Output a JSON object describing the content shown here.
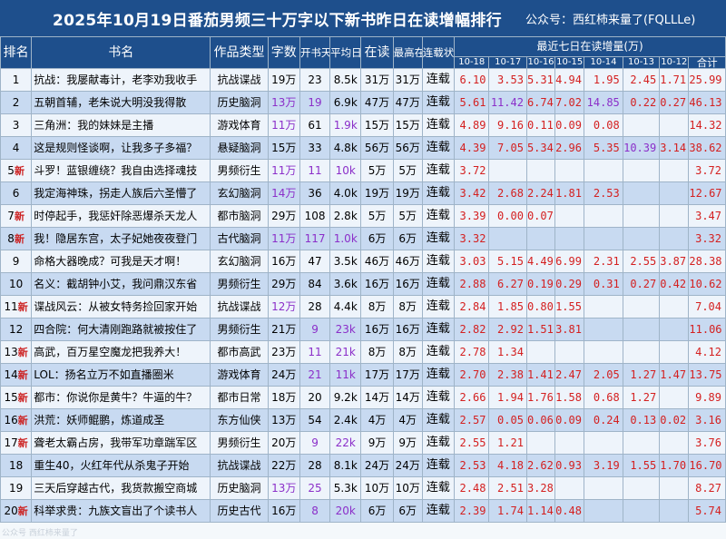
{
  "title": {
    "main": "2025年10月19日番茄男频三十万字以下新书昨日在读增幅排行",
    "sub": "公众号：西红柿来量了(FQLLLe)"
  },
  "headers": {
    "rank": "排名",
    "name": "书名",
    "type": "作品类型",
    "words": "字数",
    "days": "开书天数",
    "avg": "平均日更",
    "reading": "在读",
    "max": "最高在读",
    "status": "连载状态",
    "recent": "最近七日在读增量(万)",
    "day_labels": [
      "10-18",
      "10-17",
      "10-16",
      "10-15",
      "10-14",
      "10-13",
      "10-12"
    ],
    "total": "合计"
  },
  "new_badge": "新",
  "rows": [
    {
      "rank": "1",
      "is_new": false,
      "name": "抗战：我屡献毒计，老李劝我收手",
      "type": "抗战谍战",
      "words": "19万",
      "days": "23",
      "avg": "8.5k",
      "reading": "31万",
      "max": "31万",
      "status": "连载",
      "d": [
        "6.10",
        "3.53",
        "5.31",
        "4.94",
        "1.95",
        "2.45",
        "1.71"
      ],
      "total": "25.99"
    },
    {
      "rank": "2",
      "is_new": false,
      "name": "五朝首辅，老朱说大明没我得散",
      "type": "历史脑洞",
      "words": "13万",
      "days": "19",
      "avg": "6.9k",
      "reading": "47万",
      "max": "47万",
      "status": "连载",
      "d": [
        "5.61",
        "11.42",
        "6.74",
        "7.02",
        "14.85",
        "0.22",
        "0.27"
      ],
      "total": "46.13"
    },
    {
      "rank": "3",
      "is_new": false,
      "name": "三角洲：我的妹妹是主播",
      "type": "游戏体育",
      "words": "11万",
      "days": "61",
      "avg": "1.9k",
      "reading": "15万",
      "max": "15万",
      "status": "连载",
      "d": [
        "4.89",
        "9.16",
        "0.11",
        "0.09",
        "0.08",
        "",
        ""
      ],
      "total": "14.32"
    },
    {
      "rank": "4",
      "is_new": false,
      "name": "这是规则怪谈啊，让我多子多福？",
      "type": "悬疑脑洞",
      "words": "15万",
      "days": "33",
      "avg": "4.8k",
      "reading": "56万",
      "max": "56万",
      "status": "连载",
      "d": [
        "4.39",
        "7.05",
        "5.34",
        "2.96",
        "5.35",
        "10.39",
        "3.14"
      ],
      "total": "38.62"
    },
    {
      "rank": "5",
      "is_new": true,
      "name": "斗罗！蓝银缠绕？我自由选择魂技",
      "type": "男频衍生",
      "words": "11万",
      "days": "11",
      "avg": "10k",
      "reading": "5万",
      "max": "5万",
      "status": "连载",
      "d": [
        "3.72",
        "",
        "",
        "",
        "",
        "",
        ""
      ],
      "total": "3.72"
    },
    {
      "rank": "6",
      "is_new": false,
      "name": "我定海神珠，拐走人族后六圣懵了",
      "type": "玄幻脑洞",
      "words": "14万",
      "days": "36",
      "avg": "4.0k",
      "reading": "19万",
      "max": "19万",
      "status": "连载",
      "d": [
        "3.42",
        "2.68",
        "2.24",
        "1.81",
        "2.53",
        "",
        ""
      ],
      "total": "12.67"
    },
    {
      "rank": "7",
      "is_new": true,
      "name": "时停起手，我惩奸除恶爆杀天龙人",
      "type": "都市脑洞",
      "words": "29万",
      "days": "108",
      "avg": "2.8k",
      "reading": "5万",
      "max": "5万",
      "status": "连载",
      "d": [
        "3.39",
        "0.00",
        "0.07",
        "",
        "",
        "",
        ""
      ],
      "total": "3.47"
    },
    {
      "rank": "8",
      "is_new": true,
      "name": "我！隐居东宫，太子妃她夜夜登门",
      "type": "古代脑洞",
      "words": "11万",
      "days": "117",
      "avg": "1.0k",
      "reading": "6万",
      "max": "6万",
      "status": "连载",
      "d": [
        "3.32",
        "",
        "",
        "",
        "",
        "",
        ""
      ],
      "total": "3.32"
    },
    {
      "rank": "9",
      "is_new": false,
      "name": "命格大器晚成？可我是天才啊！",
      "type": "玄幻脑洞",
      "words": "16万",
      "days": "47",
      "avg": "3.5k",
      "reading": "46万",
      "max": "46万",
      "status": "连载",
      "d": [
        "3.03",
        "5.15",
        "4.49",
        "6.99",
        "2.31",
        "2.55",
        "3.87"
      ],
      "total": "28.38"
    },
    {
      "rank": "10",
      "is_new": false,
      "name": "名义：截胡钟小艾，我问鼎汉东省",
      "type": "男频衍生",
      "words": "29万",
      "days": "84",
      "avg": "3.6k",
      "reading": "16万",
      "max": "16万",
      "status": "连载",
      "d": [
        "2.88",
        "6.27",
        "0.19",
        "0.29",
        "0.31",
        "0.27",
        "0.42"
      ],
      "total": "10.62"
    },
    {
      "rank": "11",
      "is_new": true,
      "name": "谍战风云：从被女特务捡回家开始",
      "type": "抗战谍战",
      "words": "12万",
      "days": "28",
      "avg": "4.4k",
      "reading": "8万",
      "max": "8万",
      "status": "连载",
      "d": [
        "2.84",
        "1.85",
        "0.80",
        "1.55",
        "",
        "",
        ""
      ],
      "total": "7.04"
    },
    {
      "rank": "12",
      "is_new": false,
      "name": "四合院：何大清刚跑路就被按住了",
      "type": "男频衍生",
      "words": "21万",
      "days": "9",
      "avg": "23k",
      "reading": "16万",
      "max": "16万",
      "status": "连载",
      "d": [
        "2.82",
        "2.92",
        "1.51",
        "3.81",
        "",
        "",
        ""
      ],
      "total": "11.06"
    },
    {
      "rank": "13",
      "is_new": true,
      "name": "高武，百万星空魔龙把我养大！",
      "type": "都市高武",
      "words": "23万",
      "days": "11",
      "avg": "21k",
      "reading": "8万",
      "max": "8万",
      "status": "连载",
      "d": [
        "2.78",
        "1.34",
        "",
        "",
        "",
        "",
        ""
      ],
      "total": "4.12"
    },
    {
      "rank": "14",
      "is_new": true,
      "name": "LOL：扬名立万不如直播圈米",
      "type": "游戏体育",
      "words": "24万",
      "days": "21",
      "avg": "11k",
      "reading": "17万",
      "max": "17万",
      "status": "连载",
      "d": [
        "2.70",
        "2.38",
        "1.41",
        "2.47",
        "2.05",
        "1.27",
        "1.47"
      ],
      "total": "13.75"
    },
    {
      "rank": "15",
      "is_new": true,
      "name": "都市：你说你是黄牛？牛逼的牛？",
      "type": "都市日常",
      "words": "18万",
      "days": "20",
      "avg": "9.2k",
      "reading": "14万",
      "max": "14万",
      "status": "连载",
      "d": [
        "2.66",
        "1.94",
        "1.76",
        "1.58",
        "0.68",
        "1.27",
        ""
      ],
      "total": "9.89"
    },
    {
      "rank": "16",
      "is_new": true,
      "name": "洪荒：妖师鲲鹏，炼道成圣",
      "type": "东方仙侠",
      "words": "13万",
      "days": "54",
      "avg": "2.4k",
      "reading": "4万",
      "max": "4万",
      "status": "连载",
      "d": [
        "2.57",
        "0.05",
        "0.06",
        "0.09",
        "0.24",
        "0.13",
        "0.02"
      ],
      "total": "3.16"
    },
    {
      "rank": "17",
      "is_new": true,
      "name": "聋老太霸占房，我带军功章踹军区",
      "type": "男频衍生",
      "words": "20万",
      "days": "9",
      "avg": "22k",
      "reading": "9万",
      "max": "9万",
      "status": "连载",
      "d": [
        "2.55",
        "1.21",
        "",
        "",
        "",
        "",
        ""
      ],
      "total": "3.76"
    },
    {
      "rank": "18",
      "is_new": false,
      "name": "重生40，火红年代从杀鬼子开始",
      "type": "抗战谍战",
      "words": "22万",
      "days": "28",
      "avg": "8.1k",
      "reading": "24万",
      "max": "24万",
      "status": "连载",
      "d": [
        "2.53",
        "4.18",
        "2.62",
        "0.93",
        "3.19",
        "1.55",
        "1.70"
      ],
      "total": "16.70"
    },
    {
      "rank": "19",
      "is_new": false,
      "name": "三天后穿越古代，我货款搬空商城",
      "type": "历史脑洞",
      "words": "13万",
      "days": "25",
      "avg": "5.3k",
      "reading": "10万",
      "max": "10万",
      "status": "连载",
      "d": [
        "2.48",
        "2.51",
        "3.28",
        "",
        "",
        "",
        ""
      ],
      "total": "8.27"
    },
    {
      "rank": "20",
      "is_new": true,
      "name": "科举求贵：九族文盲出了个读书人",
      "type": "历史古代",
      "words": "16万",
      "days": "8",
      "avg": "20k",
      "reading": "6万",
      "max": "6万",
      "status": "连载",
      "d": [
        "2.39",
        "1.74",
        "1.14",
        "0.48",
        "",
        "",
        ""
      ],
      "total": "5.74"
    }
  ],
  "highlight": {
    "color": "#8b2fc9",
    "words_rows": [
      2,
      3,
      5,
      6,
      8,
      11,
      19
    ],
    "days_rows": [
      2,
      5,
      8,
      12,
      13,
      14,
      17,
      19,
      20
    ],
    "avg_rows": [
      3,
      5,
      8,
      12,
      13,
      14,
      17,
      20
    ],
    "day_cells": [
      [
        2,
        1
      ],
      [
        2,
        4
      ],
      [
        4,
        5
      ]
    ]
  },
  "colors": {
    "header_bg": "#1e4f8c",
    "row_light": "#eef4fb",
    "row_dark": "#c8daf1",
    "value_red": "#d42020",
    "new_badge": "#cc1f1f"
  },
  "watermark": "公众号 西红柿来量了"
}
